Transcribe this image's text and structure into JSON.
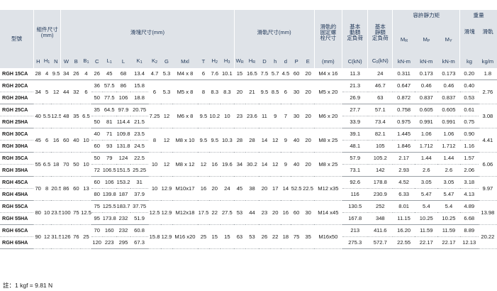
{
  "headers": {
    "model": "型號",
    "assembly": "組件尺寸\n(mm)",
    "block": "滑塊尺寸(mm)",
    "rail": "滑軌尺寸(mm)",
    "bolt": "滑軌的\n固定螺\n栓尺寸",
    "dyn": "基本\n動額\n定負荷",
    "stat": "基本\n靜額\n定負荷",
    "moment": "容許靜力矩",
    "weight": "重量",
    "w_block": "滑塊",
    "w_rail": "滑軌",
    "cols": [
      "H",
      "H1",
      "N",
      "W",
      "B",
      "B1",
      "C",
      "L1",
      "L",
      "K1",
      "K2",
      "G",
      "Mxl",
      "T",
      "H2",
      "H3",
      "WR",
      "HR",
      "D",
      "h",
      "d",
      "P",
      "E"
    ],
    "bolt_unit": "(mm)",
    "dyn_unit": "C(kN)",
    "stat_unit": "C0(kN)",
    "mr": "MR",
    "mp": "MP",
    "my": "MY",
    "mr_u": "kN-m",
    "mp_u": "kN-m",
    "my_u": "kN-m",
    "kg": "kg",
    "kgm": "kg/m"
  },
  "groups": [
    {
      "shared": {
        "H": "28",
        "H1": "4",
        "N": "9.5",
        "W": "34",
        "B": "26",
        "B1": "4",
        "K2": "4.7",
        "G": "5.3",
        "Mxl": "M4 x 8",
        "T": "6",
        "H2": "7.6",
        "H3": "10.1",
        "WR": "15",
        "HR": "16.5",
        "D": "7.5",
        "h": "5.7",
        "d": "4.5",
        "P": "60",
        "E": "20",
        "bolt": "M4 x 16",
        "wrail": "1.8"
      },
      "rows": [
        {
          "model": "RGH 15CA",
          "C": "26",
          "L1": "45",
          "L": "68",
          "K1": "13.4",
          "dyn": "11.3",
          "stat": "24",
          "mr": "0.311",
          "mp": "0.173",
          "my": "0.173",
          "wblock": "0.20"
        }
      ]
    },
    {
      "shared": {
        "H": "34",
        "H1": "5",
        "N": "12",
        "W": "44",
        "B": "32",
        "B1": "6",
        "K2": "6",
        "G": "5.3",
        "Mxl": "M5 x 8",
        "T": "8",
        "H2": "8.3",
        "H3": "8.3",
        "WR": "20",
        "HR": "21",
        "D": "9.5",
        "h": "8.5",
        "d": "6",
        "P": "30",
        "E": "20",
        "bolt": "M5 x 20",
        "wrail": "2.76"
      },
      "rows": [
        {
          "model": "RGH 20CA",
          "C": "36",
          "L1": "57.5",
          "L": "86",
          "K1": "15.8",
          "dyn": "21.3",
          "stat": "46.7",
          "mr": "0.647",
          "mp": "0.46",
          "my": "0.46",
          "wblock": "0.40"
        },
        {
          "model": "RGH 20HA",
          "C": "50",
          "L1": "77.5",
          "L": "106",
          "K1": "18.8",
          "dyn": "26.9",
          "stat": "63",
          "mr": "0.872",
          "mp": "0.837",
          "my": "0.837",
          "wblock": "0.53"
        }
      ]
    },
    {
      "shared": {
        "H": "40",
        "H1": "5.5",
        "N": "12.5",
        "W": "48",
        "B": "35",
        "B1": "6.5",
        "K2": "7.25",
        "G": "12",
        "Mxl": "M6 x 8",
        "T": "9.5",
        "H2": "10.2",
        "H3": "10",
        "WR": "23",
        "HR": "23.6",
        "D": "11",
        "h": "9",
        "d": "7",
        "P": "30",
        "E": "20",
        "bolt": "M6 x 20",
        "wrail": "3.08"
      },
      "rows": [
        {
          "model": "RGH 25CA",
          "C": "35",
          "L1": "64.5",
          "L": "97.9",
          "K1": "20.75",
          "dyn": "27.7",
          "stat": "57.1",
          "mr": "0.758",
          "mp": "0.605",
          "my": "0.605",
          "wblock": "0.61"
        },
        {
          "model": "RGH 25HA",
          "C": "50",
          "L1": "81",
          "L": "114.4",
          "K1": "21.5",
          "dyn": "33.9",
          "stat": "73.4",
          "mr": "0.975",
          "mp": "0.991",
          "my": "0.991",
          "wblock": "0.75"
        }
      ]
    },
    {
      "shared": {
        "H": "45",
        "H1": "6",
        "N": "16",
        "W": "60",
        "B": "40",
        "B1": "10",
        "K2": "8",
        "G": "12",
        "Mxl": "M8 x 10",
        "T": "9.5",
        "H2": "9.5",
        "H3": "10.3",
        "WR": "28",
        "HR": "28",
        "D": "14",
        "h": "12",
        "d": "9",
        "P": "40",
        "E": "20",
        "bolt": "M8 x 25",
        "wrail": "4.41"
      },
      "rows": [
        {
          "model": "RGH 30CA",
          "C": "40",
          "L1": "71",
          "L": "109.8",
          "K1": "23.5",
          "dyn": "39.1",
          "stat": "82.1",
          "mr": "1.445",
          "mp": "1.06",
          "my": "1.06",
          "wblock": "0.90"
        },
        {
          "model": "RGH 30HA",
          "C": "60",
          "L1": "93",
          "L": "131.8",
          "K1": "24.5",
          "dyn": "48.1",
          "stat": "105",
          "mr": "1.846",
          "mp": "1.712",
          "my": "1.712",
          "wblock": "1.16"
        }
      ]
    },
    {
      "shared": {
        "H": "55",
        "H1": "6.5",
        "N": "18",
        "W": "70",
        "B": "50",
        "B1": "10",
        "K2": "10",
        "G": "12",
        "Mxl": "M8 x 12",
        "T": "12",
        "H2": "16",
        "H3": "19.6",
        "WR": "34",
        "HR": "30.2",
        "D": "14",
        "h": "12",
        "d": "9",
        "P": "40",
        "E": "20",
        "bolt": "M8 x 25",
        "wrail": "6.06"
      },
      "rows": [
        {
          "model": "RGH 35CA",
          "C": "50",
          "L1": "79",
          "L": "124",
          "K1": "22.5",
          "dyn": "57.9",
          "stat": "105.2",
          "mr": "2.17",
          "mp": "1.44",
          "my": "1.44",
          "wblock": "1.57"
        },
        {
          "model": "RGH 35HA",
          "C": "72",
          "L1": "106.5",
          "L": "151.5",
          "K1": "25.25",
          "dyn": "73.1",
          "stat": "142",
          "mr": "2.93",
          "mp": "2.6",
          "my": "2.6",
          "wblock": "2.06"
        }
      ]
    },
    {
      "shared": {
        "H": "70",
        "H1": "8",
        "N": "20.5",
        "W": "86",
        "B": "60",
        "B1": "13",
        "K2": "10",
        "G": "12.9",
        "Mxl": "M10x17",
        "T": "16",
        "H2": "20",
        "H3": "24",
        "WR": "45",
        "HR": "38",
        "D": "20",
        "h": "17",
        "d": "14",
        "P": "52.5",
        "E": "22.5",
        "bolt": "M12 x35",
        "wrail": "9.97"
      },
      "rows": [
        {
          "model": "RGH 45CA",
          "C": "60",
          "L1": "106",
          "L": "153.2",
          "K1": "31",
          "dyn": "92.6",
          "stat": "178.8",
          "mr": "4.52",
          "mp": "3.05",
          "my": "3.05",
          "wblock": "3.18"
        },
        {
          "model": "RGH 45HA",
          "C": "80",
          "L1": "139.8",
          "L": "187",
          "K1": "37.9",
          "dyn": "116",
          "stat": "230.9",
          "mr": "6.33",
          "mp": "5.47",
          "my": "5.47",
          "wblock": "4.13"
        }
      ]
    },
    {
      "shared": {
        "H": "80",
        "H1": "10",
        "N": "23.5",
        "W": "100",
        "B": "75",
        "B1": "12.5",
        "K2": "12.5",
        "G": "12.9",
        "Mxl": "M12x18",
        "T": "17.5",
        "H2": "22",
        "H3": "27.5",
        "WR": "53",
        "HR": "44",
        "D": "23",
        "h": "20",
        "d": "16",
        "P": "60",
        "E": "30",
        "bolt": "M14 x45",
        "wrail": "13.98"
      },
      "rows": [
        {
          "model": "RGH 55CA",
          "C": "75",
          "L1": "125.5",
          "L": "183.7",
          "K1": "37.75",
          "dyn": "130.5",
          "stat": "252",
          "mr": "8.01",
          "mp": "5.4",
          "my": "5.4",
          "wblock": "4.89"
        },
        {
          "model": "RGH 55HA",
          "C": "95",
          "L1": "173.8",
          "L": "232",
          "K1": "51.9",
          "dyn": "167.8",
          "stat": "348",
          "mr": "11.15",
          "mp": "10.25",
          "my": "10.25",
          "wblock": "6.68"
        }
      ]
    },
    {
      "shared": {
        "H": "90",
        "H1": "12",
        "N": "31.5",
        "W": "126",
        "B": "76",
        "B1": "25",
        "K2": "15.8",
        "G": "12.9",
        "Mxl": "M16 x20",
        "T": "25",
        "H2": "15",
        "H3": "15",
        "WR": "63",
        "HR": "53",
        "D": "26",
        "h": "22",
        "d": "18",
        "P": "75",
        "E": "35",
        "bolt": "M16x50",
        "wrail": "20.22"
      },
      "rows": [
        {
          "model": "RGH 65CA",
          "C": "70",
          "L1": "160",
          "L": "232",
          "K1": "60.8",
          "dyn": "213",
          "stat": "411.6",
          "mr": "16.20",
          "mp": "11.59",
          "my": "11.59",
          "wblock": "8.89"
        },
        {
          "model": "RGH 65HA",
          "C": "120",
          "L1": "223",
          "L": "295",
          "K1": "67.3",
          "dyn": "275.3",
          "stat": "572.7",
          "mr": "22.55",
          "mp": "22.17",
          "my": "22.17",
          "wblock": "12.13"
        }
      ]
    }
  ],
  "footnote": "註：1 kgf = 9.81 N"
}
